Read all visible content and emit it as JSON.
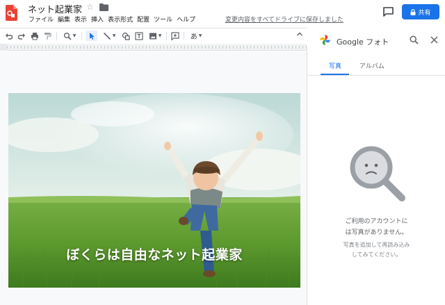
{
  "document": {
    "title": "ネット起業家",
    "save_status": "変更内容をすべてドライブに保存しました"
  },
  "menu": [
    {
      "label": "ファイル"
    },
    {
      "label": "編集"
    },
    {
      "label": "表示"
    },
    {
      "label": "挿入"
    },
    {
      "label": "表示形式"
    },
    {
      "label": "配置"
    },
    {
      "label": "ツール"
    },
    {
      "label": "ヘルプ"
    }
  ],
  "share": {
    "label": "共有"
  },
  "toolbar": {
    "text_style_glyph": "あ",
    "icons": [
      "undo-icon",
      "redo-icon",
      "print-icon",
      "paint-format-icon",
      "zoom-icon",
      "select-icon",
      "line-icon",
      "shape-icon",
      "textbox-icon",
      "image-icon",
      "insert-comment-icon",
      "text-input-icon"
    ]
  },
  "slide": {
    "caption": "ぼくらは自由なネット起業家"
  },
  "side_panel": {
    "title": "Google フォト",
    "tabs": [
      {
        "label": "写真",
        "active": true
      },
      {
        "label": "アルバム",
        "active": false
      }
    ],
    "empty_message_line1": "ご利用のアカウントに",
    "empty_message_line2": "は写真がありません。",
    "empty_hint_line1": "写真を追加して再読み込み",
    "empty_hint_line2": "してみてください。"
  },
  "colors": {
    "accent": "#1a73e8",
    "app_logo": "#ea4335"
  }
}
